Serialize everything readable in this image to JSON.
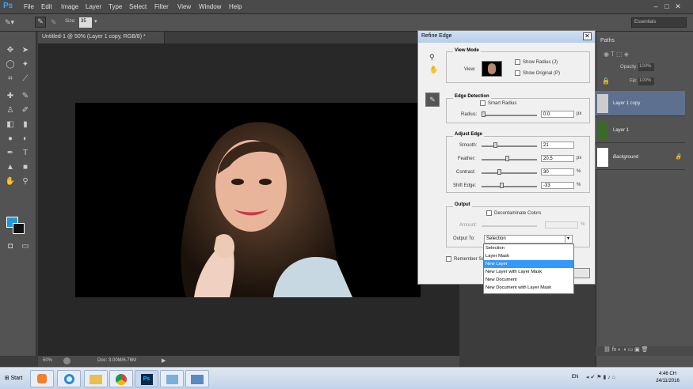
{
  "menubar": {
    "logo": "Ps",
    "items": [
      "File",
      "Edit",
      "Image",
      "Layer",
      "Type",
      "Select",
      "Filter",
      "View",
      "Window",
      "Help"
    ],
    "window_buttons": [
      "–",
      "□",
      "✕"
    ]
  },
  "options": {
    "size_label": "Size:",
    "size_value": "35",
    "workspace": "Essentials"
  },
  "document": {
    "tab_title": "Untitled-1 @ 50% (Layer 1 copy, RGB/8) *",
    "zoom": "50%",
    "doc_info": "Doc: 3.00M/6.76M"
  },
  "panels": {
    "tab": "Paths",
    "opacity_label": "Opacity:",
    "opacity_value": "100%",
    "fill_label": "Fill:",
    "fill_value": "100%",
    "layers": [
      "Layer 1 copy",
      "Layer 1",
      "Background"
    ]
  },
  "dialog": {
    "title": "Refine Edge",
    "view_mode": {
      "title": "View Mode",
      "view_label": "View:",
      "show_radius": "Show Radius (J)",
      "show_original": "Show Original (P)"
    },
    "edge_detection": {
      "title": "Edge Detection",
      "smart_radius": "Smart Radius",
      "radius_label": "Radius:",
      "radius_value": "0.0",
      "radius_unit": "px"
    },
    "adjust_edge": {
      "title": "Adjust Edge",
      "smooth_label": "Smooth:",
      "smooth_value": "21",
      "feather_label": "Feather:",
      "feather_value": "20.5",
      "feather_unit": "px",
      "contrast_label": "Contrast:",
      "contrast_value": "30",
      "contrast_unit": "%",
      "shift_label": "Shift Edge:",
      "shift_value": "-33",
      "shift_unit": "%"
    },
    "output": {
      "title": "Output",
      "decontaminate": "Decontaminate Colors",
      "amount_label": "Amount:",
      "amount_unit": "%",
      "output_to_label": "Output To:",
      "output_to_value": "Selection",
      "options": [
        "Selection",
        "Layer Mask",
        "New Layer",
        "New Layer with Layer Mask",
        "New Document",
        "New Document with Layer Mask"
      ],
      "selected_option": "New Layer"
    },
    "remember": "Remember Se"
  },
  "taskbar": {
    "start": "Start",
    "lang": "EN",
    "time": "4:46 CH",
    "date": "24/11/2016"
  }
}
